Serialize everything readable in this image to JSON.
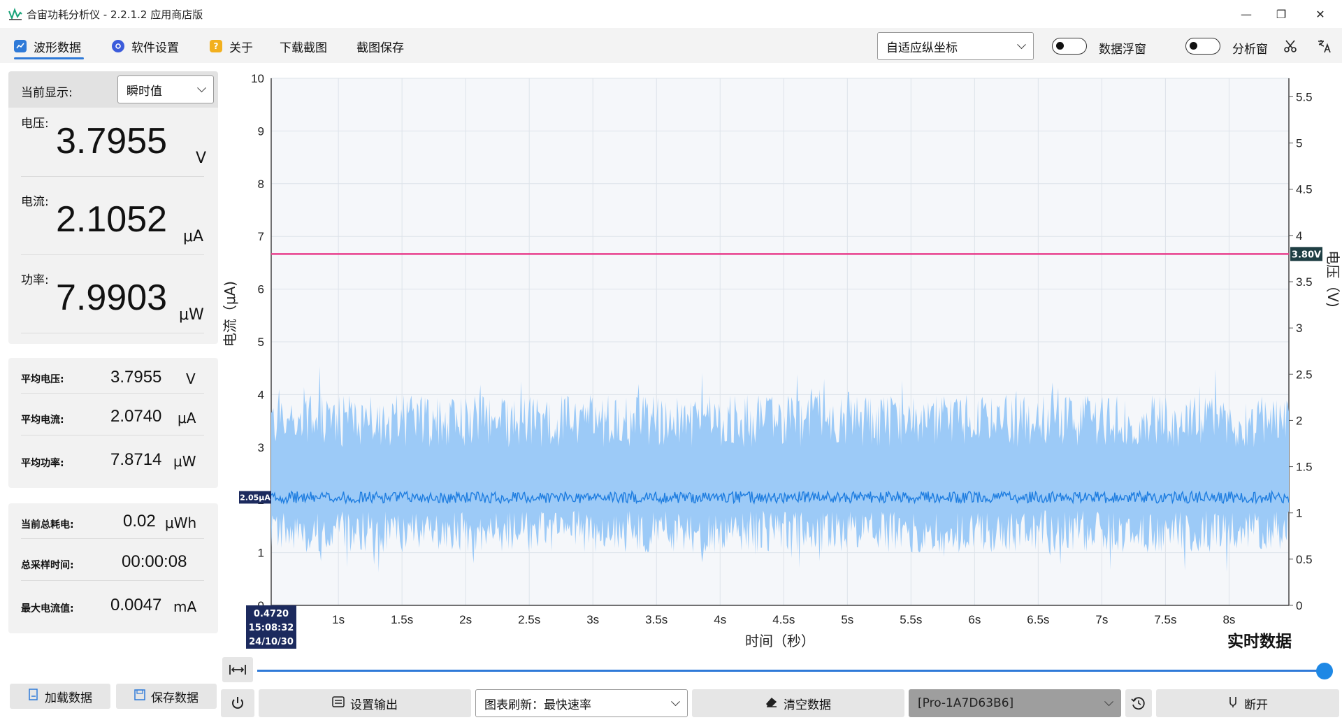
{
  "window": {
    "title": "合宙功耗分析仪 - 2.2.1.2 应用商店版",
    "minimize_glyph": "—",
    "maximize_glyph": "❐",
    "close_glyph": "✕"
  },
  "menu": [
    {
      "label": "波形数据",
      "icon": "chart-icon",
      "color": "#2f7ad8"
    },
    {
      "label": "软件设置",
      "icon": "gear-icon",
      "color": "#3b5bdb"
    },
    {
      "label": "关于",
      "icon": "help-icon",
      "color": "#f2b01e"
    },
    {
      "label": "下载截图"
    },
    {
      "label": "截图保存"
    }
  ],
  "toolbar": {
    "axis_mode": "自适应纵坐标",
    "data_float_label": "数据浮窗",
    "analysis_label": "分析窗"
  },
  "display": {
    "label": "当前显示:",
    "mode": "瞬时值"
  },
  "instant": {
    "voltage_label": "电压:",
    "voltage_value": "3.7955",
    "voltage_unit": "V",
    "current_label": "电流:",
    "current_value": "2.1052",
    "current_unit": "μA",
    "power_label": "功率:",
    "power_value": "7.9903",
    "power_unit": "μW"
  },
  "average": {
    "voltage_label": "平均电压:",
    "voltage_value": "3.7955",
    "voltage_unit": "V",
    "current_label": "平均电流:",
    "current_value": "2.0740",
    "current_unit": "μA",
    "power_label": "平均功率:",
    "power_value": "7.8714",
    "power_unit": "μW"
  },
  "totals": {
    "energy_label": "当前总耗电:",
    "energy_value": "0.02",
    "energy_unit": "μWh",
    "time_label": "总采样时间:",
    "time_value": "00:00:08",
    "max_label": "最大电流值:",
    "max_value": "0.0047",
    "max_unit": "mA"
  },
  "left_buttons": {
    "load": "加载数据",
    "save": "保存数据"
  },
  "bottom": {
    "set_output": "设置输出",
    "refresh": "图表刷新：最快速率",
    "clear": "清空数据",
    "device": "[Pro-1A7D63B6]",
    "disconnect": "断开"
  },
  "realtime_label": "实时数据",
  "chart_data": {
    "type": "area",
    "xlabel": "时间（秒）",
    "ylabel_left": "电流（μA)",
    "ylabel_right": "电压（V)",
    "x_ticks": [
      "1s",
      "1.5s",
      "2s",
      "2.5s",
      "3s",
      "3.5s",
      "4s",
      "4.5s",
      "5s",
      "5.5s",
      "6s",
      "6.5s",
      "7s",
      "7.5s",
      "8s"
    ],
    "xlim": [
      0.472,
      8.47
    ],
    "ylim_left": [
      0,
      10
    ],
    "ylim_right": [
      0,
      5.7
    ],
    "y_left_ticks": [
      "0",
      "1",
      "2",
      "3",
      "4",
      "5",
      "6",
      "7",
      "8",
      "9",
      "10"
    ],
    "y_right_ticks": [
      "0",
      "0.5",
      "1",
      "1.5",
      "2",
      "2.5",
      "3",
      "3.5",
      "4",
      "4.5",
      "5",
      "5.5"
    ],
    "series": [
      {
        "axis": "right",
        "color": "#e83e8c",
        "values": [
          3.8
        ]
      },
      {
        "axis": "left",
        "color": "#1e7de0",
        "mean": 2.05,
        "band_min": 0.7,
        "band_max": 4.1,
        "band_color": "#9ccaf7"
      }
    ],
    "current_marker": "2.05μA",
    "voltage_marker": "3.80V",
    "cursor": {
      "x": "0.4720",
      "time": "15:08:32",
      "date": "24/10/30"
    },
    "grid": true
  }
}
